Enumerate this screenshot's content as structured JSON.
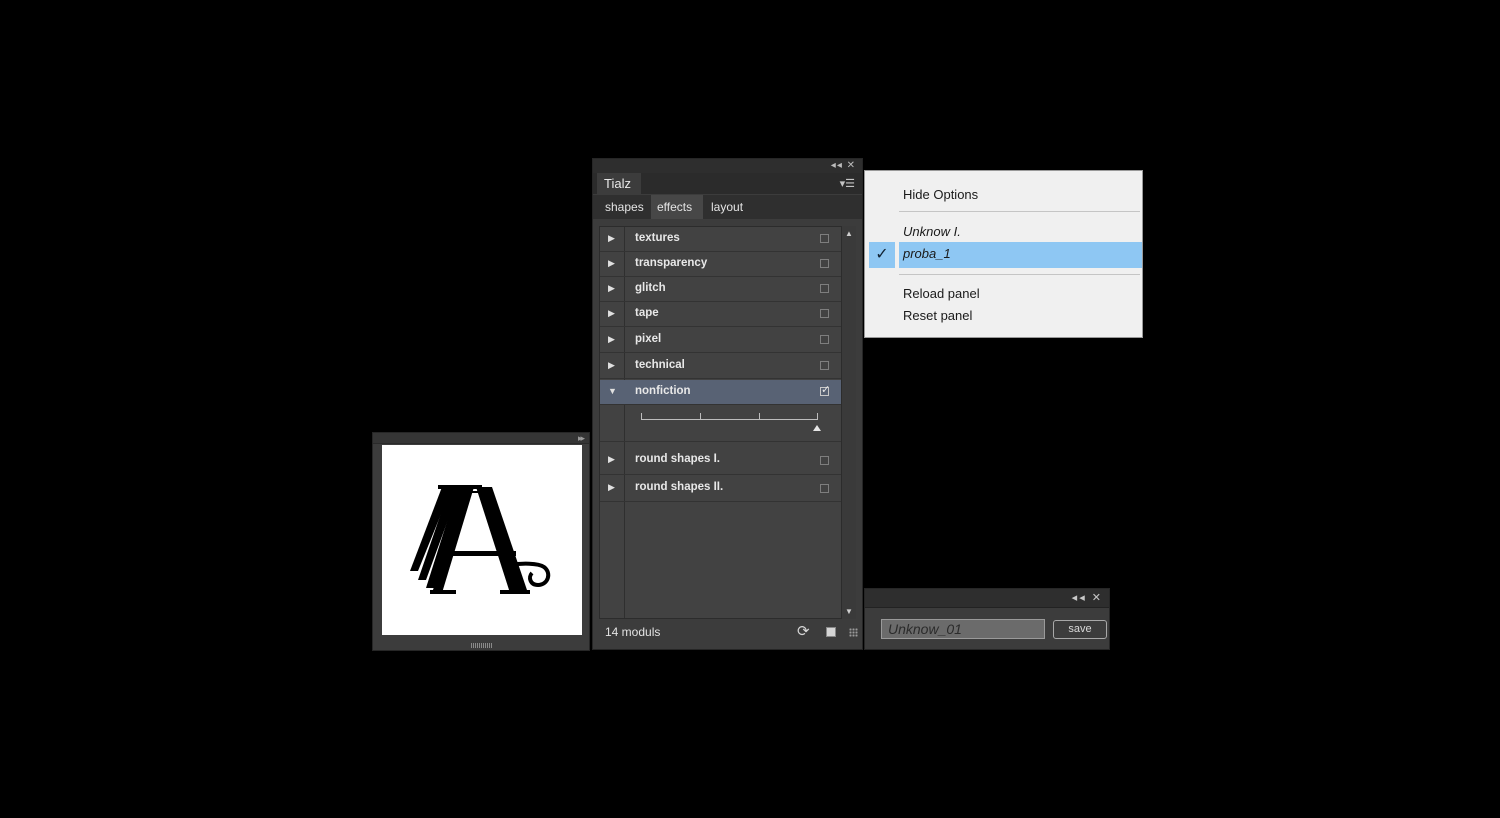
{
  "preview_panel": {
    "collapse_icon": "double-chevron-right-icon",
    "glyph": "A"
  },
  "main_panel": {
    "panel_tab": "Tialz",
    "titlebar_icons": "collapse-and-close-icons",
    "subtabs": [
      {
        "label": "shapes",
        "active": false
      },
      {
        "label": "effects",
        "active": true
      },
      {
        "label": "layout",
        "active": false
      }
    ],
    "modules_before": [
      {
        "label": "textures",
        "checked": false
      },
      {
        "label": "transparency",
        "checked": false
      },
      {
        "label": "glitch",
        "checked": false
      },
      {
        "label": "tape",
        "checked": false
      },
      {
        "label": "pixel",
        "checked": false
      },
      {
        "label": "technical",
        "checked": false
      },
      {
        "label": "nonfiction",
        "checked": true,
        "expanded": true
      }
    ],
    "nonfiction_slider_value": 1.0,
    "modules_after": [
      {
        "label": "round shapes I.",
        "checked": false
      },
      {
        "label": "round shapes II.",
        "checked": false
      }
    ],
    "footer": {
      "count": "14 moduls"
    }
  },
  "menu": {
    "hide_options": "Hide Options",
    "presets": [
      {
        "label": "Unknow I.",
        "selected": false
      },
      {
        "label": "proba_1",
        "selected": true
      }
    ],
    "reload": "Reload panel",
    "reset": "Reset panel",
    "selection_color": "#8ec7f3"
  },
  "save_panel": {
    "name_value": "Unknow_01",
    "save_label": "save"
  }
}
